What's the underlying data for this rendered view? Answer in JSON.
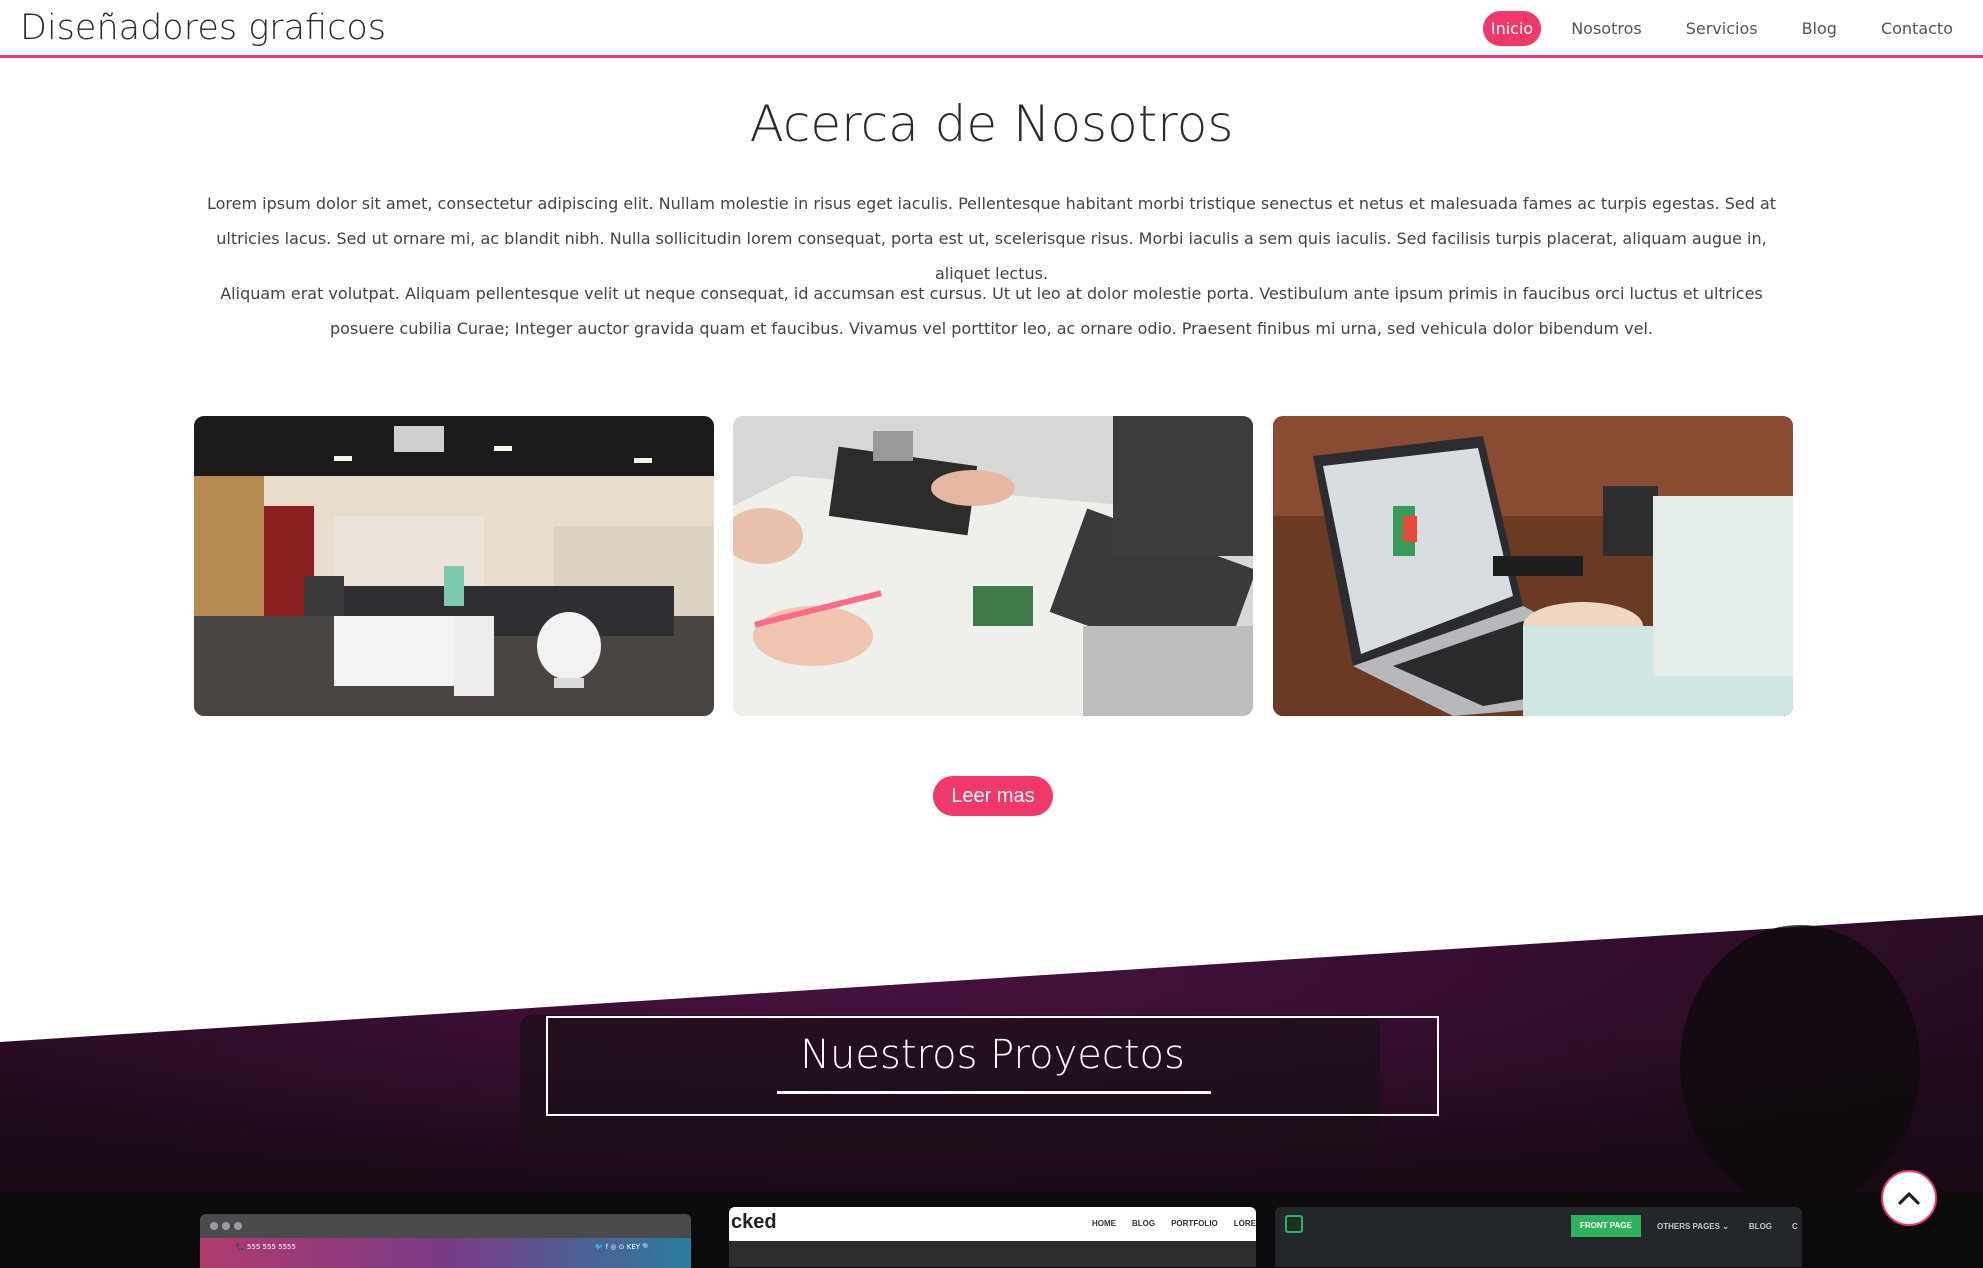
{
  "navbar": {
    "brand": "Diseñadores graficos",
    "links": [
      "Inicio",
      "Nosotros",
      "Servicios",
      "Blog",
      "Contacto"
    ],
    "active": "Inicio"
  },
  "about": {
    "title": "Acerca de Nosotros",
    "paragraph_1": "Lorem ipsum dolor sit amet, consectetur adipiscing elit. Nullam molestie in risus eget iaculis. Pellentesque habitant morbi tristique senectus et netus et malesuada fames ac turpis egestas. Sed at ultricies lacus. Sed ut ornare mi, ac blandit nibh. Nulla sollicitudin lorem consequat, porta est ut, scelerisque risus. Morbi iaculis a sem quis iaculis. Sed facilisis turpis placerat, aliquam augue in, aliquet lectus.",
    "paragraph_2": "Aliquam erat volutpat. Aliquam pellentesque velit ut neque consequat, id accumsan est cursus. Ut ut leo at dolor molestie porta. Vestibulum ante ipsum primis in faucibus orci luctus et ultrices posuere cubilia Curae; Integer auctor gravida quam et faucibus. Vivamus vel porttitor leo, ac ornare odio. Praesent finibus mi urna, sed vehicula dolor bibendum vel.",
    "read_more": "Leer mas"
  },
  "projects": {
    "title": "Nuestros Proyectos",
    "thumb_1": {
      "phone": "📞 555 555 5555",
      "icons": "🐦 f ◎ ⊙  KEY   🔍"
    },
    "thumb_2": {
      "logo": "cked",
      "menu": [
        "HOME",
        "BLOG",
        "PORTFOLIO",
        "LORE"
      ]
    },
    "thumb_3": {
      "button": "FRONT PAGE",
      "menu": [
        "OTHERS PAGES ⌄",
        "BLOG",
        "C"
      ]
    }
  },
  "colors": {
    "accent": "#f0386b",
    "dark_section": "#1e0c1a"
  },
  "icons": {
    "back_to_top": "chevron-up-icon"
  }
}
